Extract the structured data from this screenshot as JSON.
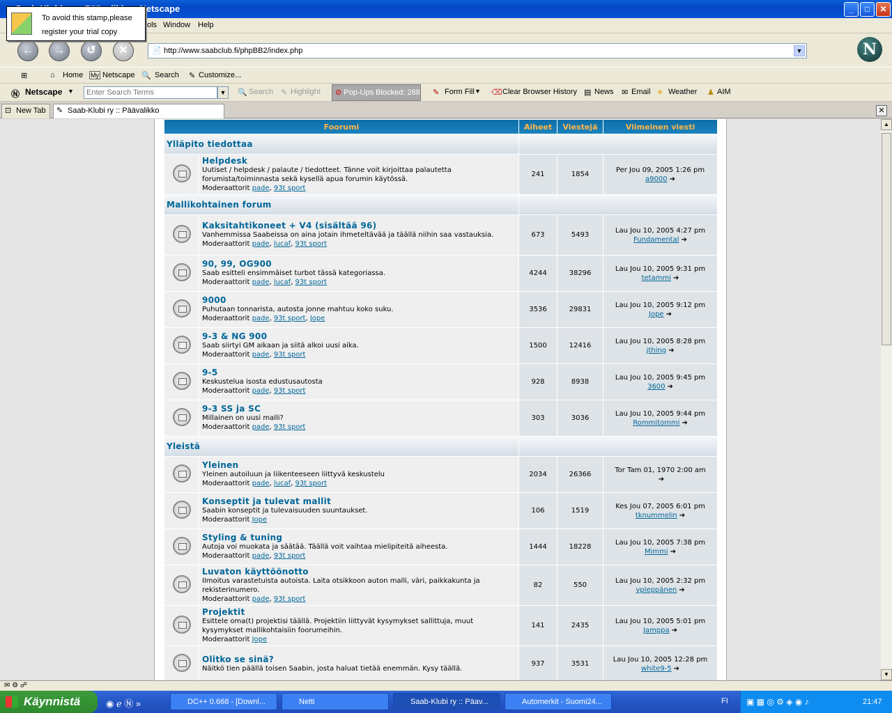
{
  "window": {
    "title": "Saab-Klubi ry :: Päävalikko - Netscape",
    "minimize": "_",
    "maximize": "□",
    "close": "✕"
  },
  "popup": {
    "line1": "To avoid this stamp,please",
    "line2": "register your trial copy"
  },
  "menu": {
    "items": [
      "ols",
      "Window",
      "Help"
    ]
  },
  "nav": {
    "url": "http://www.saabclub.fi/phpBB2/index.php",
    "logo": "N"
  },
  "personal_toolbar": {
    "items": [
      "Home",
      "Netscape",
      "Search",
      "Customize..."
    ]
  },
  "search_toolbar": {
    "brand": "Netscape",
    "placeholder": "Enter Search Terms",
    "search": "Search",
    "highlight": "Highlight",
    "popups": "Pop-Ups Blocked: 288",
    "formfill": "Form Fill",
    "clear": "Clear Browser History",
    "news": "News",
    "email": "Email",
    "weather": "Weather",
    "aim": "AIM"
  },
  "tabs": [
    {
      "label": "New Tab"
    },
    {
      "label": "Saab-Klubi ry :: Päävalikko"
    }
  ],
  "forum": {
    "headers": [
      "Foorumi",
      "Aiheet",
      "Viestejä",
      "Viimeinen viesti"
    ],
    "mod_label": "Moderaattorit",
    "categories": [
      {
        "name": "Ylläpito tiedottaa",
        "forums": [
          {
            "name": "Helpdesk",
            "desc": "Uutiset / helpdesk / palaute / tiedotteet. Tänne voit kirjoittaa palautetta forumista/toiminnasta sekä kysellä apua forumin käytössä.",
            "mods": [
              "pade",
              "93t sport"
            ],
            "topics": "241",
            "posts": "1854",
            "last_date": "Per Jou 09, 2005 1:26 pm",
            "last_user": "a9000"
          }
        ]
      },
      {
        "name": "Mallikohtainen forum",
        "forums": [
          {
            "name": "Kaksitahtikoneet + V4 (sisältää 96)",
            "desc": "Vanhemmissa Saabeissa on aina jotain ihmeteltävää ja täällä niihin saa vastauksia.",
            "mods": [
              "pade",
              "lucaf",
              "93t sport"
            ],
            "topics": "673",
            "posts": "5493",
            "last_date": "Lau Jou 10, 2005 4:27 pm",
            "last_user": "Fundamental"
          },
          {
            "name": "90, 99, OG900",
            "desc": "Saab esitteli ensimmäiset turbot tässä kategoriassa.",
            "mods": [
              "pade",
              "lucaf",
              "93t sport"
            ],
            "topics": "4244",
            "posts": "38296",
            "last_date": "Lau Jou 10, 2005 9:31 pm",
            "last_user": "tetammi"
          },
          {
            "name": "9000",
            "desc": "Puhutaan tonnarista, autosta jonne mahtuu koko suku.",
            "mods": [
              "pade",
              "93t sport",
              "Jope"
            ],
            "topics": "3536",
            "posts": "29831",
            "last_date": "Lau Jou 10, 2005 9:12 pm",
            "last_user": "Jope"
          },
          {
            "name": "9-3 & NG 900",
            "desc": "Saab siirtyi GM aikaan ja siitä alkoi uusi aika.",
            "mods": [
              "pade",
              "93t sport"
            ],
            "topics": "1500",
            "posts": "12416",
            "last_date": "Lau Jou 10, 2005 8:28 pm",
            "last_user": "jthing"
          },
          {
            "name": "9-5",
            "desc": "Keskustelua isosta edustusautosta",
            "mods": [
              "pade",
              "93t sport"
            ],
            "topics": "928",
            "posts": "8938",
            "last_date": "Lau Jou 10, 2005 9:45 pm",
            "last_user": "3600"
          },
          {
            "name": "9-3 SS ja SC",
            "desc": "Millainen on uusi malli?",
            "mods": [
              "pade",
              "93t sport"
            ],
            "topics": "303",
            "posts": "3036",
            "last_date": "Lau Jou 10, 2005 9:44 pm",
            "last_user": "Rommitommi"
          }
        ]
      },
      {
        "name": "Yleistä",
        "forums": [
          {
            "name": "Yleinen",
            "desc": "Yleinen autoiluun ja liikenteeseen liittyvä keskustelu",
            "mods": [
              "pade",
              "lucaf",
              "93t sport"
            ],
            "topics": "2034",
            "posts": "26366",
            "last_date": "Tor Tam 01, 1970 2:00 am",
            "last_user": ""
          },
          {
            "name": "Konseptit ja tulevat mallit",
            "desc": "Saabin konseptit ja tulevaisuuden suuntaukset.",
            "mods": [
              "Jope"
            ],
            "topics": "106",
            "posts": "1519",
            "last_date": "Kes Jou 07, 2005 6:01 pm",
            "last_user": "tknummelin"
          },
          {
            "name": "Styling & tuning",
            "desc": "Autoja voi muokata ja säätää. Täällä voit vaihtaa mielipiteitä aiheesta.",
            "mods": [
              "pade",
              "93t sport"
            ],
            "topics": "1444",
            "posts": "18228",
            "last_date": "Lau Jou 10, 2005 7:38 pm",
            "last_user": "Mimmi"
          },
          {
            "name": "Luvaton käyttöönotto",
            "desc": "Ilmoitus varastetuista autoista. Laita otsikkoon auton malli, väri, paikkakunta ja rekisterinumero.",
            "mods": [
              "pade",
              "93t sport"
            ],
            "topics": "82",
            "posts": "550",
            "last_date": "Lau Jou 10, 2005 2:32 pm",
            "last_user": "vpleppänen"
          },
          {
            "name": "Projektit",
            "desc": "Esittele oma(t) projektisi täällä. Projektiin liittyvät kysymykset sallittuja, muut kysymykset mallikohtaisiin foorumeihin.",
            "mods": [
              "Jope"
            ],
            "topics": "141",
            "posts": "2435",
            "last_date": "Lau Jou 10, 2005 5:01 pm",
            "last_user": "Jamppa"
          },
          {
            "name": "Olitko se sinä?",
            "desc": "Näitkö tien päällä toisen Saabin, josta haluat tietää enemmän. Kysy täällä.",
            "mods": [],
            "topics": "937",
            "posts": "3531",
            "last_date": "Lau Jou 10, 2005 12:28 pm",
            "last_user": "white9-5"
          }
        ]
      }
    ]
  },
  "taskbar": {
    "start": "Käynnistä",
    "tasks": [
      "DC++ 0.668 - [Downl...",
      "Netti",
      "Saab-Klubi ry :: Päav...",
      "Automerkit - Suomi24..."
    ],
    "lang": "FI",
    "clock": "21:47"
  },
  "colors": {
    "header_bg": "#1a82bf",
    "header_text": "#ffb547",
    "link": "#006699",
    "row_bg": "#efefef",
    "num_bg": "#dee3e7"
  }
}
